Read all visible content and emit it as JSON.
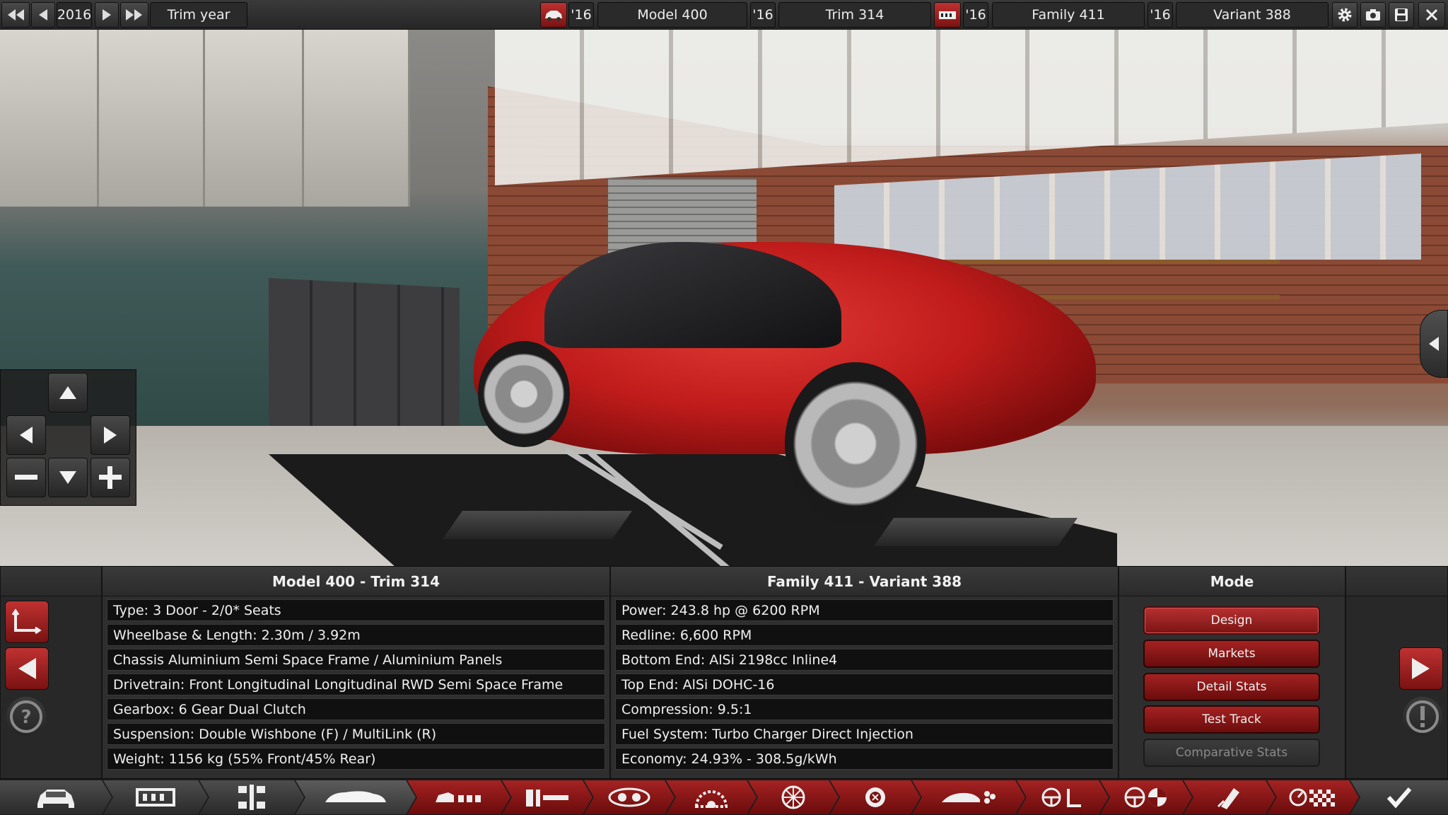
{
  "topbar": {
    "year": "2016",
    "trim_year_label": "Trim year",
    "model_year": "'16",
    "model": "Model 400",
    "trim_year": "'16",
    "trim": "Trim 314",
    "family_year": "'16",
    "family": "Family 411",
    "variant_year": "'16",
    "variant": "Variant 388",
    "icons": [
      "fast-back-icon",
      "back-icon",
      "forward-icon",
      "fast-forward-icon",
      "car-body-icon",
      "engine-block-icon",
      "settings-gear-icon",
      "camera-icon",
      "save-icon",
      "close-icon"
    ]
  },
  "info": {
    "car_header": "Model 400 - Trim 314",
    "car_rows": [
      "Type: 3 Door - 2/0* Seats",
      "Wheelbase & Length: 2.30m / 3.92m",
      "Chassis Aluminium Semi Space Frame / Aluminium Panels",
      "Drivetrain: Front Longitudinal Longitudinal RWD Semi Space Frame",
      "Gearbox: 6 Gear Dual Clutch",
      "Suspension: Double Wishbone (F) / MultiLink (R)",
      "Weight: 1156 kg (55% Front/45% Rear)"
    ],
    "engine_header": "Family 411 - Variant 388",
    "engine_rows": [
      "Power: 243.8 hp @ 6200 RPM",
      "Redline:  6,600 RPM",
      "Bottom End: AlSi 2198cc Inline4",
      "Top End: AlSi DOHC-16",
      "Compression: 9.5:1",
      "Fuel System: Turbo Charger Direct Injection",
      "Economy: 24.93% - 308.5g/kWh"
    ],
    "mode_header": "Mode",
    "mode_buttons": [
      "Design",
      "Markets",
      "Detail Stats",
      "Test Track",
      "Comparative Stats"
    ]
  },
  "bottombar": {
    "icons": [
      "car-front-icon",
      "chassis-icon",
      "drivetrain-icon",
      "body-icon",
      "fixtures-icon",
      "interior-icon",
      "suspension-icon",
      "brakes-icon",
      "wheels-icon",
      "tires-icon",
      "aero-icon",
      "steering-icon",
      "safety-icon",
      "paint-icon",
      "test-drive-icon",
      "confirm-check-icon"
    ]
  },
  "colors": {
    "accent_red": "#a52222",
    "panel_bg": "#2e2e2e",
    "row_bg": "#101010"
  }
}
